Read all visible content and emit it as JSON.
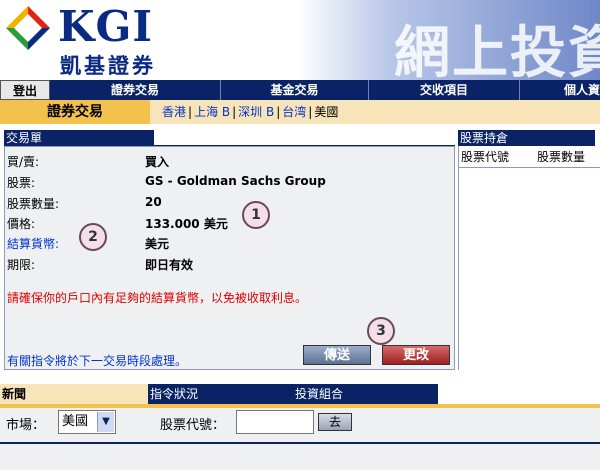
{
  "brand": {
    "logo_text": "KGI",
    "logo_subtext": "凱基證券",
    "banner_text": "網上投資"
  },
  "main_nav": {
    "logout": "登出",
    "items": [
      "證券交易",
      "基金交易",
      "交收項目",
      "個人資"
    ]
  },
  "sub_nav": {
    "active": "證券交易",
    "markets": [
      "香港",
      "上海 B",
      "深圳 B",
      "台湾",
      "美國"
    ],
    "active_market": "美國"
  },
  "order": {
    "title": "交易單",
    "side_label": "買/賣:",
    "side_value": "買入",
    "stock_label": "股票:",
    "stock_value": "GS - Goldman Sachs Group",
    "qty_label": "股票數量:",
    "qty_value": "20",
    "price_label": "價格:",
    "price_value": "133.000 美元",
    "currency_label": "結算貨幣:",
    "currency_value": "美元",
    "validity_label": "期限:",
    "validity_value": "即日有效",
    "warning": "請確保你的戶口內有足夠的結算貨幣，以免被收取利息。",
    "note": "有關指令將於下一交易時段處理。",
    "send_button": "傳送",
    "change_button": "更改"
  },
  "callouts": [
    "1",
    "2",
    "3"
  ],
  "holdings": {
    "title": "股票持倉",
    "col_code": "股票代號",
    "col_qty": "股票數量"
  },
  "bottom_tabs": {
    "news": "新聞",
    "orders": "指令狀況",
    "portfolio": "投資組合"
  },
  "search": {
    "market_label": "市場：",
    "market_value": "美國",
    "code_label": "股票代號：",
    "code_value": "",
    "go_button": "去"
  },
  "colors": {
    "navy": "#0a2366",
    "gold": "#f3c24c",
    "warning_red": "#e00000",
    "link_blue": "#0033cc"
  }
}
